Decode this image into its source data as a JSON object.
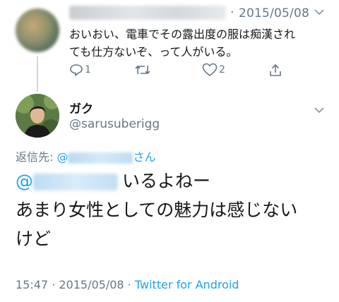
{
  "parent_tweet": {
    "separator": "·",
    "date": "2015/05/08",
    "text_line1": "おいおい、電車でその露出度の服は痴漢され",
    "text_line2": "ても仕方ないぞ、って人がいる。",
    "reply_count": "1",
    "like_count": "2"
  },
  "main_tweet": {
    "display_name": "ガク",
    "screen_name": "@sarusuberigg",
    "reply_label": "返信先: ",
    "reply_at": "@",
    "reply_suffix": "さん",
    "mention_at": "@",
    "text_line1_rest": "いるよねー",
    "text_line2": "あまり女性としての魅力は感じない",
    "text_line3": "けど",
    "time": "15:47",
    "dot": "·",
    "date": "2015/05/08",
    "source": "Twitter for Android"
  },
  "icons": {
    "reply": "reply-icon",
    "retweet": "retweet-icon",
    "like": "heart-icon",
    "share": "share-icon",
    "menu": "chevron-down-icon"
  },
  "colors": {
    "link": "#1da1f2",
    "secondary": "#657786",
    "text": "#14171a"
  }
}
